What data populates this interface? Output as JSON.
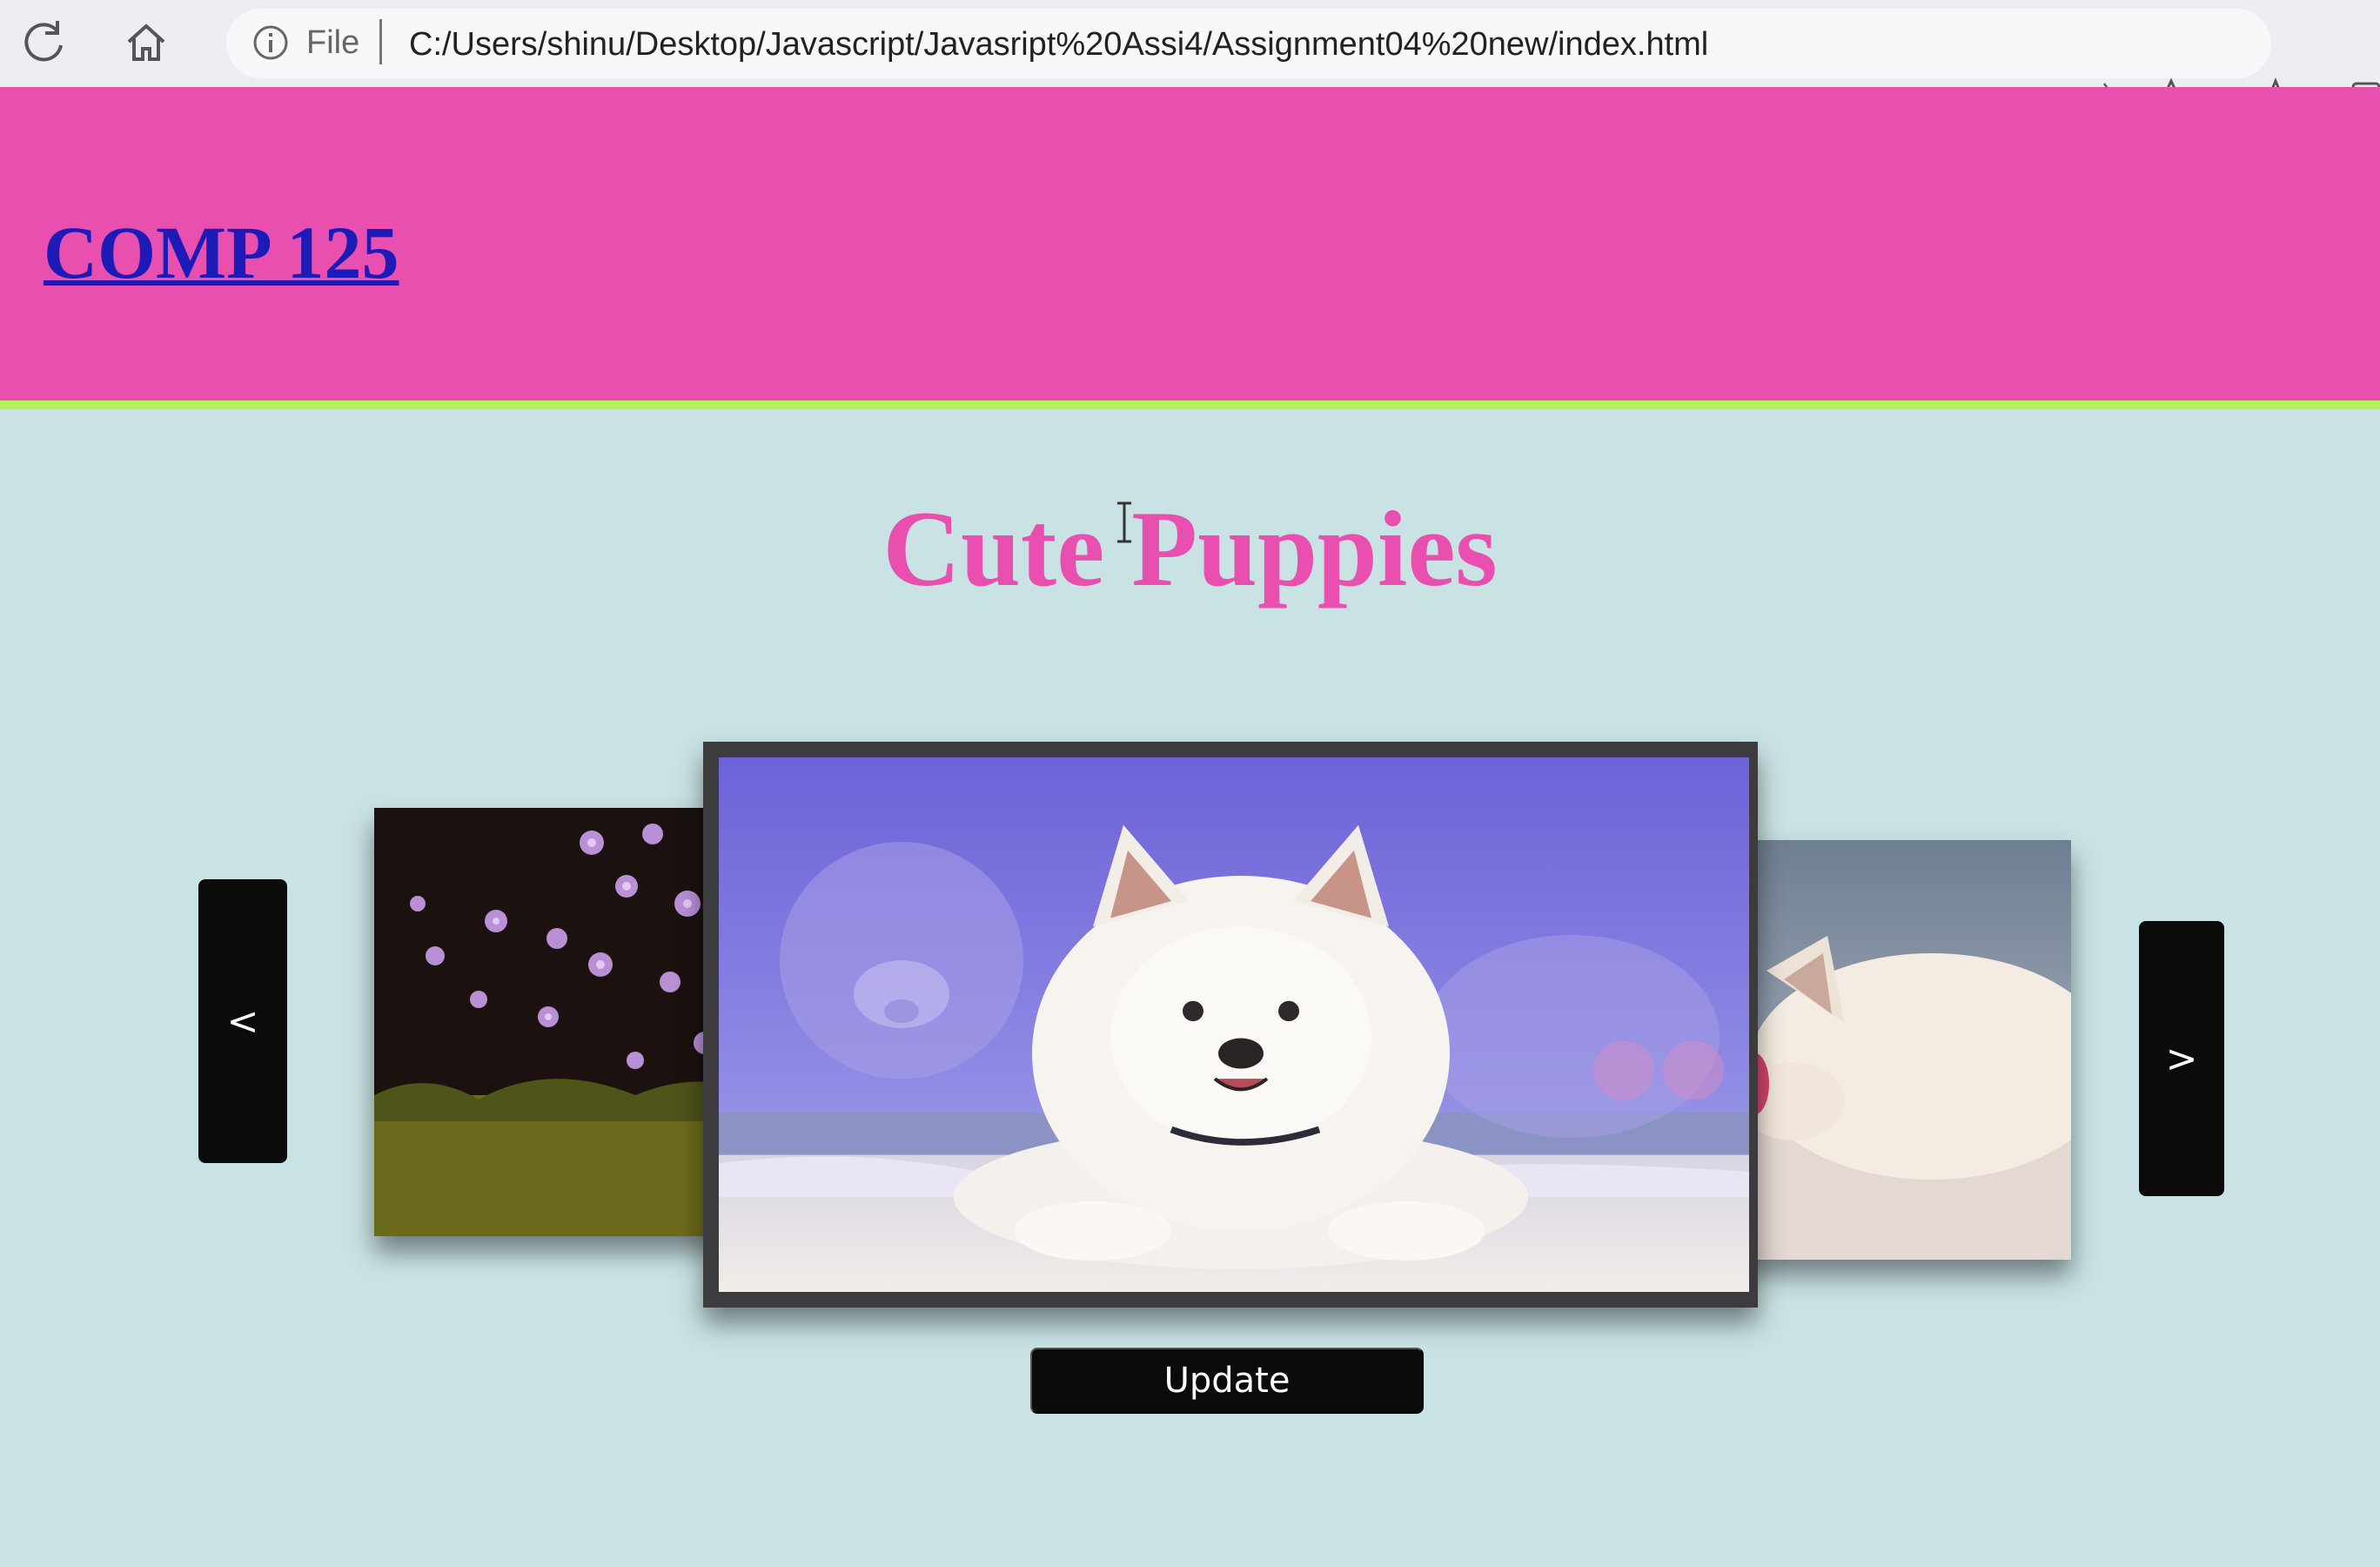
{
  "browser": {
    "address_scheme": "File",
    "url": "C:/Users/shinu/Desktop/Javascript/Javasript%20Assi4/Assignment04%20new/index.html"
  },
  "header": {
    "site_title": "COMP 125"
  },
  "main": {
    "heading": "Cute Puppies"
  },
  "carousel": {
    "prev_label": "<",
    "next_label": ">",
    "update_label": "Update",
    "slides": [
      "flowers-slide",
      "white-puppy-beach-slide",
      "sleeping-puppy-slide"
    ]
  },
  "colors": {
    "header_bg": "#e84faf",
    "header_border": "#b6f05a",
    "page_bg": "#c9e3e4",
    "title_link": "#1c1bb8",
    "heading": "#e84faf",
    "button_bg": "#0b0b0c"
  }
}
